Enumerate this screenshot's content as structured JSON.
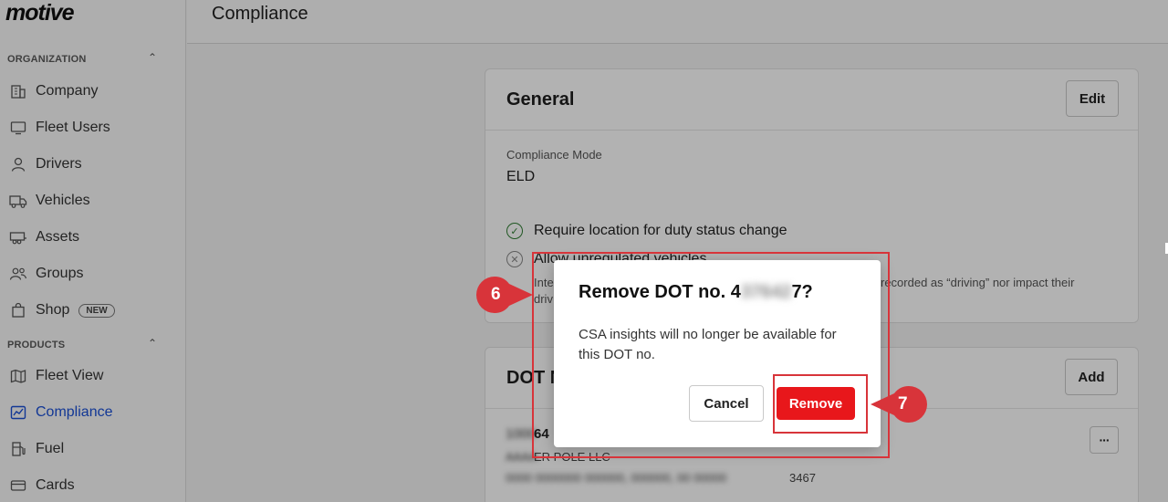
{
  "app": {
    "logo": "motive"
  },
  "sidebar": {
    "organization_label": "ORGANIZATION",
    "products_label": "PRODUCTS",
    "org_items": [
      {
        "label": "Company",
        "icon": "building-icon"
      },
      {
        "label": "Fleet Users",
        "icon": "monitor-icon"
      },
      {
        "label": "Drivers",
        "icon": "person-icon"
      },
      {
        "label": "Vehicles",
        "icon": "truck-icon"
      },
      {
        "label": "Assets",
        "icon": "trailer-icon"
      },
      {
        "label": "Groups",
        "icon": "group-icon"
      },
      {
        "label": "Shop",
        "icon": "shopping-bag-icon",
        "badge": "NEW"
      }
    ],
    "product_items": [
      {
        "label": "Fleet View",
        "icon": "map-icon"
      },
      {
        "label": "Compliance",
        "icon": "chart-icon",
        "active": true
      },
      {
        "label": "Fuel",
        "icon": "fuel-icon"
      },
      {
        "label": "Cards",
        "icon": "card-icon"
      }
    ]
  },
  "header": {
    "title": "Compliance"
  },
  "general": {
    "title": "General",
    "edit_label": "Edit",
    "mode_label": "Compliance Mode",
    "mode_value": "ELD",
    "require_location": "Require location for duty status change",
    "allow_unregulated": "Allow unregulated vehicles",
    "unregulated_desc_start": "Inte",
    "unregulated_desc_end": "recorded as “driving” nor impact their",
    "unregulated_desc_line2": "driv"
  },
  "dot": {
    "title": "DOT N",
    "add_label": "Add",
    "more_label": "···",
    "row_number_visible": "64",
    "row_company_visible": "ER POLE LLC",
    "row_address_visible": "3467"
  },
  "modal": {
    "title_prefix": "Remove DOT no. 4",
    "title_blurred": "37642",
    "title_suffix": "7?",
    "body": "CSA insights will no longer be available for this DOT no.",
    "cancel_label": "Cancel",
    "remove_label": "Remove"
  },
  "annotations": {
    "step_6": "6",
    "step_7": "7",
    "color": "#d8343a"
  }
}
